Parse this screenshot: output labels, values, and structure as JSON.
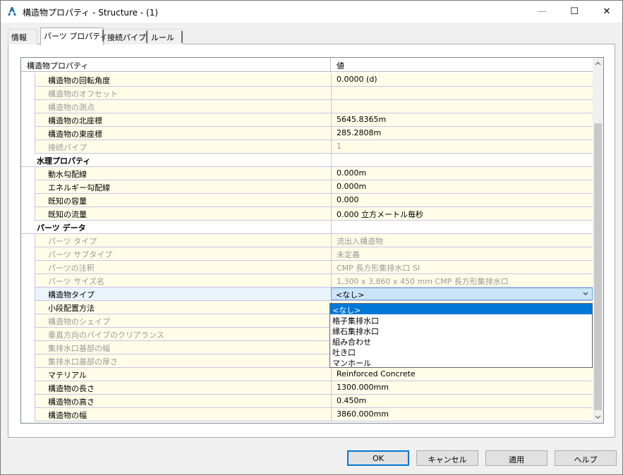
{
  "window": {
    "title": "構造物プロパティ - Structure - (1)",
    "min_glyph": "—",
    "max_glyph": "☐",
    "close_glyph": "✕"
  },
  "tabs": [
    {
      "label": "情報"
    },
    {
      "label": "パーツ プロパティ"
    },
    {
      "label": "接続パイプ"
    },
    {
      "label": "ルール"
    }
  ],
  "grid": {
    "header": {
      "name": "構造物プロパティ",
      "value": "値"
    },
    "rows": [
      {
        "label": "構造物の回転角度",
        "value": "0.0000 (d)"
      },
      {
        "label": "構造物のオフセット",
        "value": ""
      },
      {
        "label": "構造物の測点",
        "value": ""
      },
      {
        "label": "構造物の北座標",
        "value": "5645.8365m"
      },
      {
        "label": "構造物の東座標",
        "value": "285.2808m"
      },
      {
        "label": "接続パイプ",
        "value": "1"
      },
      {
        "label": "水理プロパティ",
        "value": ""
      },
      {
        "label": "動水勾配線",
        "value": "0.000m"
      },
      {
        "label": "エネルギー勾配線",
        "value": "0.000m"
      },
      {
        "label": "既知の容量",
        "value": "0.000"
      },
      {
        "label": "既知の流量",
        "value": "0.000 立方メートル毎秒"
      },
      {
        "label": "パーツ データ",
        "value": ""
      },
      {
        "label": "パーツ タイプ",
        "value": "流出入構造物"
      },
      {
        "label": "パーツ サブタイプ",
        "value": "未定義"
      },
      {
        "label": "パーツの注釈",
        "value": "CMP 長方形集排水口 SI"
      },
      {
        "label": "パーツ サイズ名",
        "value": "1,300 x 3,860 x 450 mm CMP 長方形集排水口"
      },
      {
        "label": "構造物タイプ",
        "value": "<なし>"
      },
      {
        "label": "小段配置方法",
        "value": ""
      },
      {
        "label": "構造物のシェイプ",
        "value": ""
      },
      {
        "label": "垂直方向のパイプのクリアランス",
        "value": ""
      },
      {
        "label": "集排水口基部の幅",
        "value": ""
      },
      {
        "label": "集排水口基部の厚さ",
        "value": ""
      },
      {
        "label": "マテリアル",
        "value": "Reinforced Concrete"
      },
      {
        "label": "構造物の長さ",
        "value": "1300.000mm"
      },
      {
        "label": "構造物の高さ",
        "value": "0.450m"
      },
      {
        "label": "構造物の幅",
        "value": "3860.000mm"
      }
    ]
  },
  "dropdown": {
    "options": [
      "<なし>",
      "格子集排水口",
      "縁石集排水口",
      "組み合わせ",
      "吐き口",
      "マンホール"
    ]
  },
  "buttons": {
    "ok": "OK",
    "cancel": "キャンセル",
    "apply": "適用",
    "help": "ヘルプ"
  },
  "colors": {
    "accent": "#0078d7",
    "row_bg": "#fffde8",
    "grid_line": "#c9c3e8"
  },
  "icons": {
    "app": "autodesk-a-icon",
    "expand": "minus-box-icon",
    "dropdown": "chevron-down-icon"
  }
}
